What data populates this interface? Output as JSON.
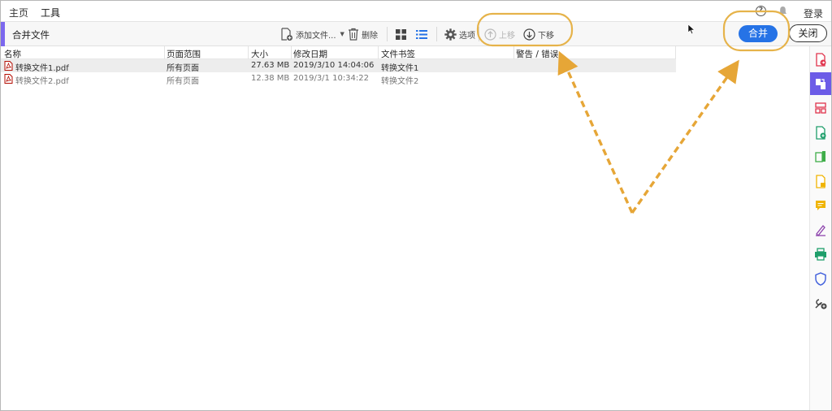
{
  "nav": {
    "home": "主页",
    "tools": "工具",
    "login": "登录"
  },
  "toolbar": {
    "title": "合并文件",
    "add_files": "添加文件...",
    "delete": "删除",
    "options": "选项",
    "move_up": "上移",
    "move_down": "下移",
    "merge": "合并",
    "close": "关闭"
  },
  "table": {
    "headers": [
      "名称",
      "页面范围",
      "大小",
      "修改日期",
      "文件书签",
      "警告 / 错误"
    ],
    "rows": [
      {
        "name": "转换文件1.pdf",
        "range": "所有页面",
        "size": "27.63 MB",
        "date": "2019/3/10 14:04:06",
        "bookmark": "转换文件1",
        "warning": ""
      },
      {
        "name": "转换文件2.pdf",
        "range": "所有页面",
        "size": "12.38 MB",
        "date": "2019/3/1 10:34:22",
        "bookmark": "转换文件2",
        "warning": ""
      }
    ]
  },
  "sidebar": {
    "icons": [
      "export-pdf-icon",
      "combine-files-icon",
      "organize-pages-icon",
      "create-pdf-icon",
      "edit-pdf-icon",
      "comment-file-icon",
      "comment-icon",
      "fill-sign-icon",
      "print-production-icon",
      "protect-icon",
      "more-tools-icon"
    ]
  },
  "colors": {
    "accent": "#7c68ee",
    "primary_button": "#2673e6",
    "highlight": "#e6b34a",
    "arrow": "#e6a637"
  }
}
